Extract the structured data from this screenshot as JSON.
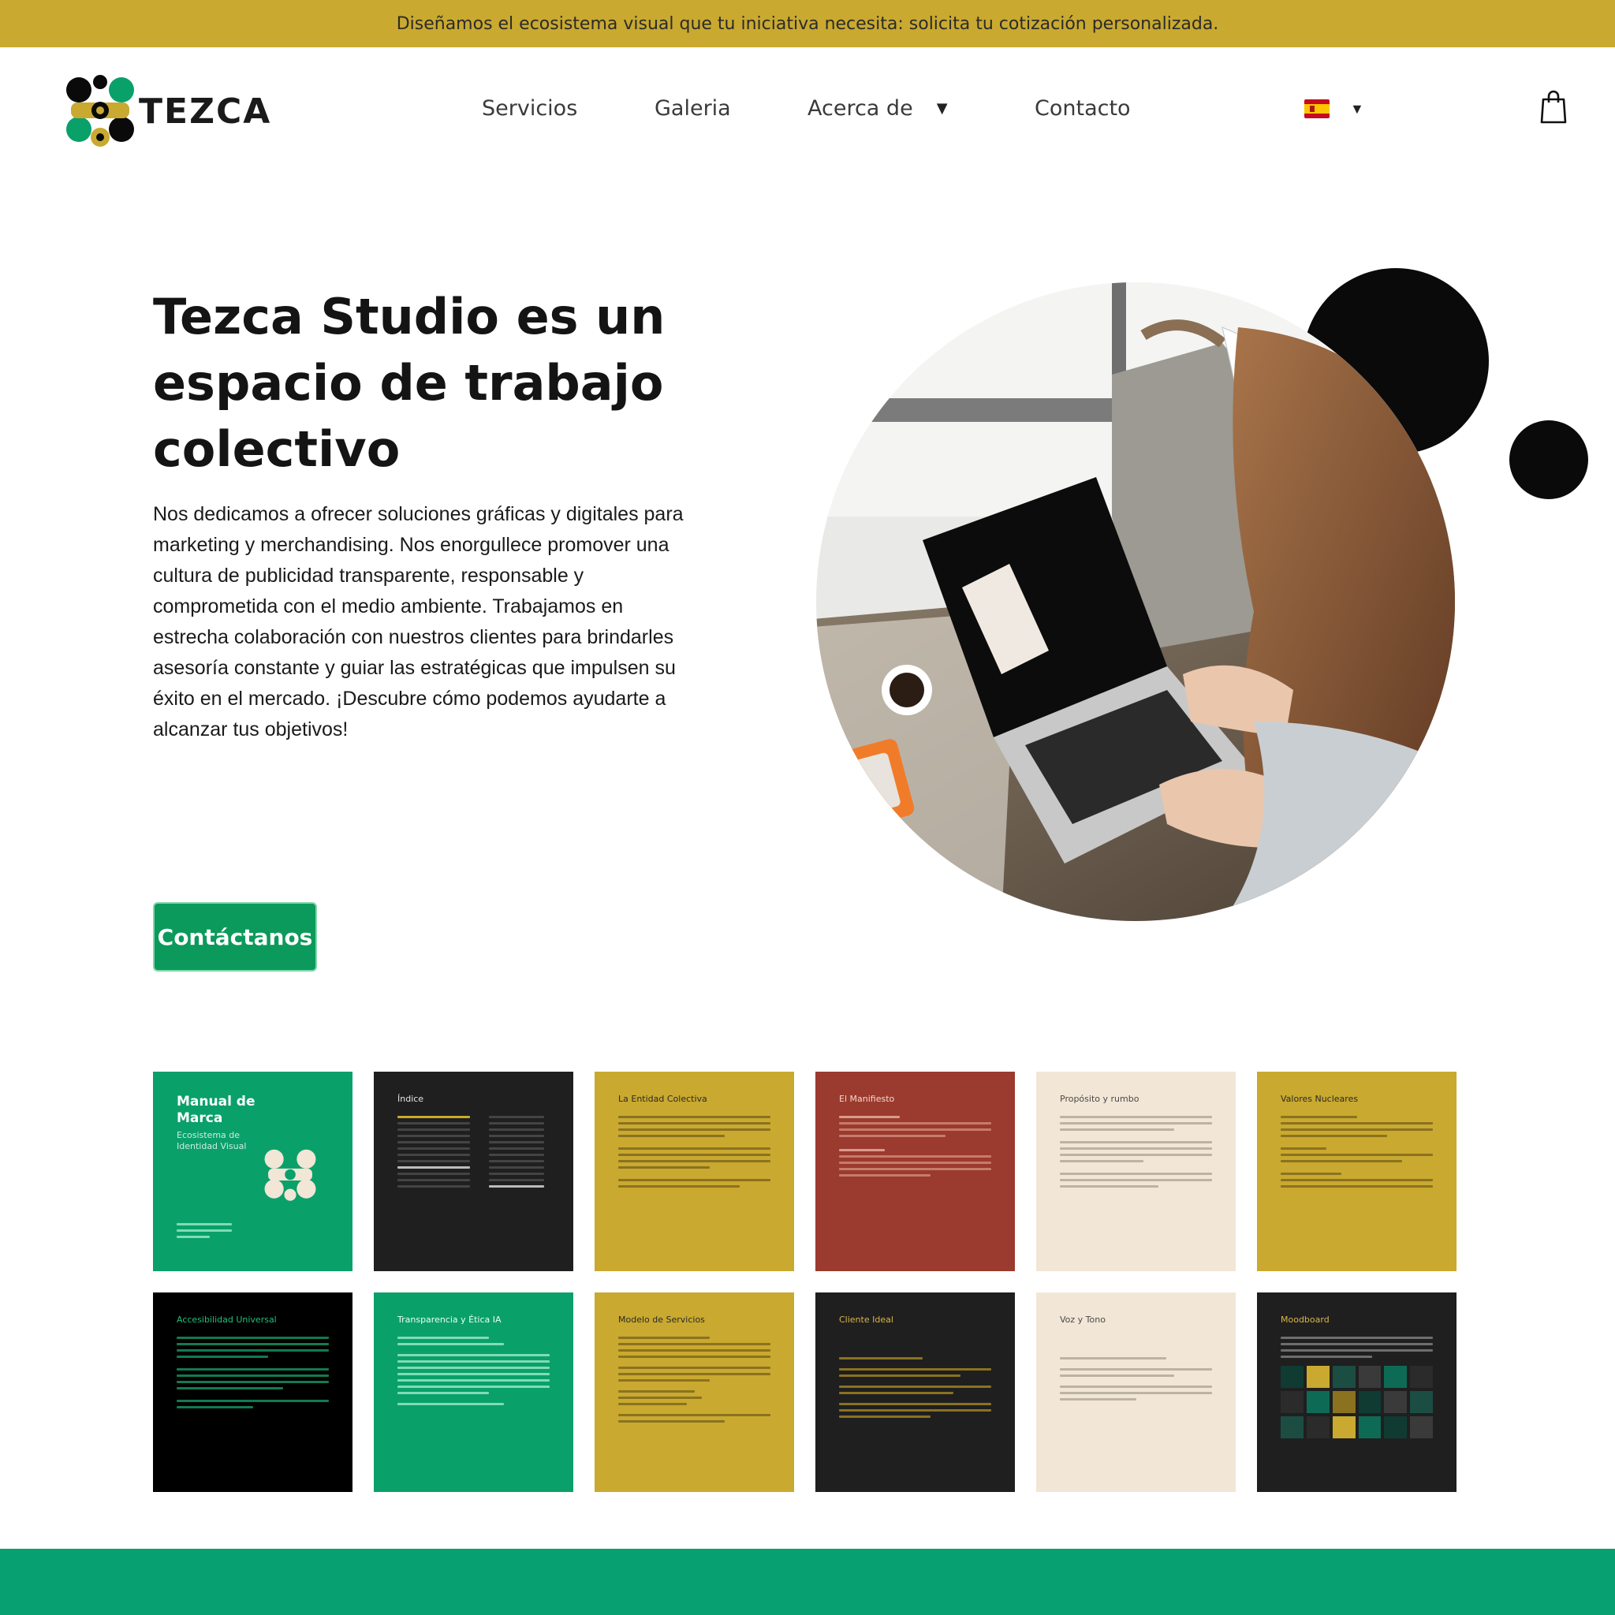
{
  "announcement": "Diseñamos el ecosistema visual que tu iniciativa necesita: solicita tu cotización personalizada.",
  "brand": {
    "name": "TEZCA",
    "green": "#0b9a5b",
    "gold": "#c9a92f",
    "black": "#0a0a0a"
  },
  "nav": {
    "items": [
      "Servicios",
      "Galeria",
      "Acerca de",
      "Contacto"
    ],
    "language": "es",
    "language_icon": "spain-flag-icon",
    "cart_icon": "shopping-bag-icon"
  },
  "hero": {
    "title": "Tezca Studio es un espacio de trabajo colectivo",
    "body": "Nos dedicamos a ofrecer soluciones gráficas y digitales para marketing y merchandising. Nos enorgullece promover una cultura de publicidad transparente, responsable y comprometida con el medio ambiente. Trabajamos en estrecha colaboración con nuestros clientes para brindarles asesoría constante y guiar las estratégicas que impulsen su éxito en el mercado. ¡Descubre cómo podemos ayudarte a alcanzar tus objetivos!",
    "cta": "Contáctanos",
    "image": "woman-working-on-laptop-photo"
  },
  "gallery": [
    {
      "title": "Manual de Marca",
      "subtitle": "Ecosistema de Identidad Visual",
      "bg": "#0aa06a",
      "fg": "#ffffff"
    },
    {
      "title": "Índice",
      "bg": "#1f1f1f",
      "fg": "#d9b54a"
    },
    {
      "title": "La Entidad Colectiva",
      "bg": "#c9a92f",
      "fg": "#2a2a2a"
    },
    {
      "title": "El Manifiesto",
      "bg": "#9b3a2e",
      "fg": "#f1d9cf"
    },
    {
      "title": "Propósito y rumbo",
      "bg": "#f2e6d6",
      "fg": "#4a4a4a"
    },
    {
      "title": "Valores Nucleares",
      "bg": "#c9a92f",
      "fg": "#2a2a2a"
    },
    {
      "title": "Accesibilidad Universal",
      "bg": "#000000",
      "fg": "#1ec07c"
    },
    {
      "title": "Transparencia y Ética IA",
      "bg": "#0aa06a",
      "fg": "#eafff4"
    },
    {
      "title": "Modelo de Servicios",
      "bg": "#c9a92f",
      "fg": "#2a2a2a"
    },
    {
      "title": "Cliente Ideal",
      "bg": "#1f1f1f",
      "fg": "#d9b54a"
    },
    {
      "title": "Voz y Tono",
      "bg": "#f2e6d6",
      "fg": "#4a4a4a"
    },
    {
      "title": "Moodboard",
      "bg": "#1f1f1f",
      "fg": "#d9b54a"
    }
  ]
}
